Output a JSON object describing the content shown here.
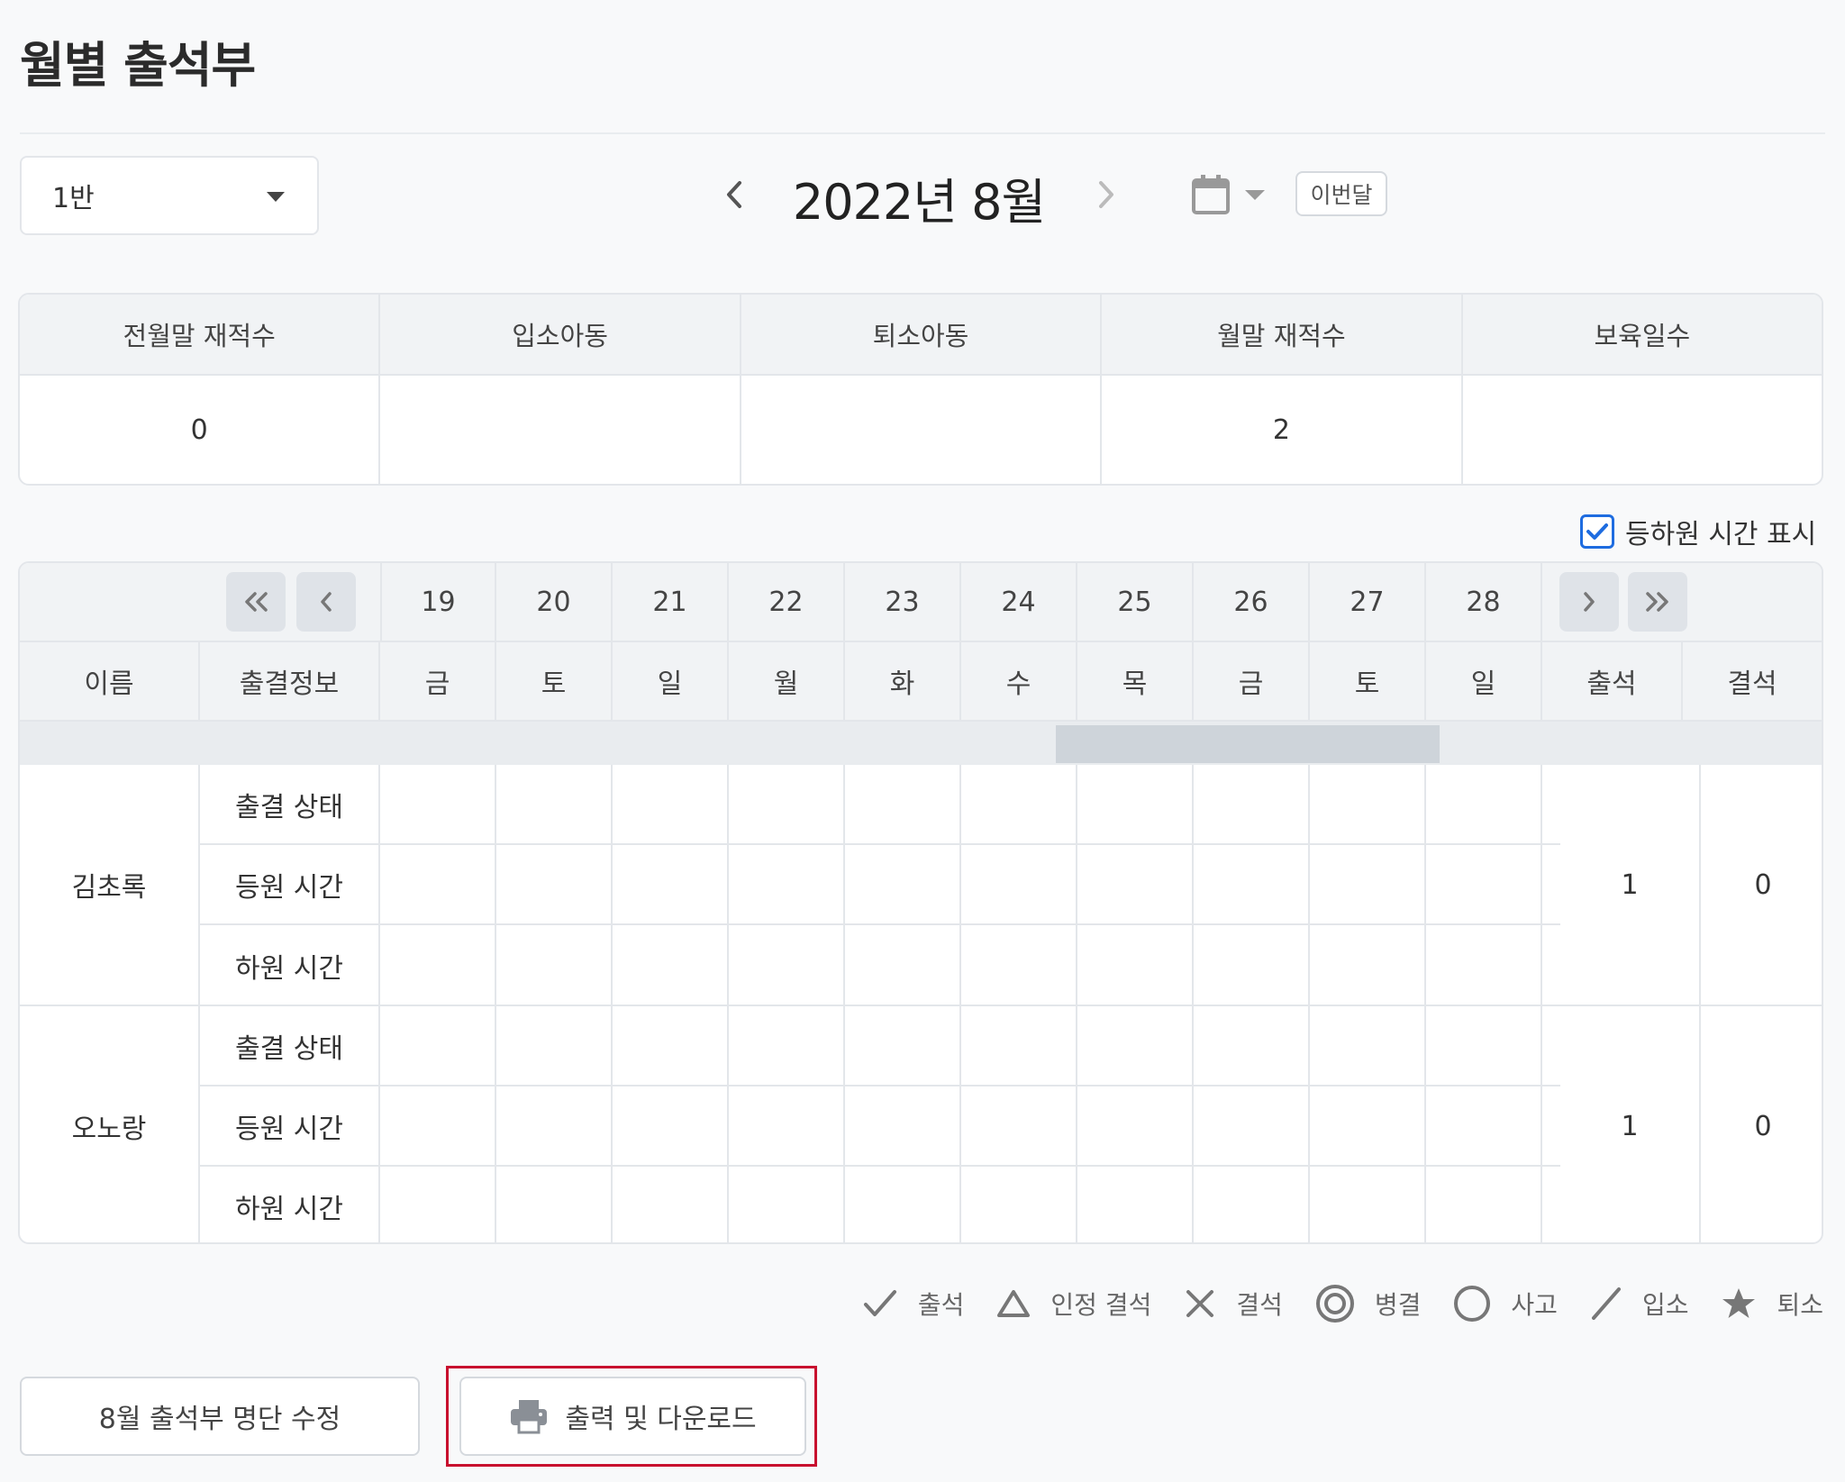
{
  "page": {
    "title": "월별 출석부"
  },
  "class_select": {
    "value": "1반"
  },
  "month_nav": {
    "label": "2022년 8월",
    "this_month_label": "이번달"
  },
  "summary": {
    "headers": [
      "전월말 재적수",
      "입소아동",
      "퇴소아동",
      "월말 재적수",
      "보육일수"
    ],
    "values": [
      "0",
      "",
      "",
      "2",
      ""
    ]
  },
  "time_toggle": {
    "label": "등하원 시간 표시",
    "checked": true
  },
  "grid": {
    "dates": [
      "19",
      "20",
      "21",
      "22",
      "23",
      "24",
      "25",
      "26",
      "27",
      "28"
    ],
    "weekdays": [
      "금",
      "토",
      "일",
      "월",
      "화",
      "수",
      "목",
      "금",
      "토",
      "일"
    ],
    "headers": {
      "name": "이름",
      "info": "출결정보",
      "present": "출석",
      "absent": "결석"
    },
    "row_labels": [
      "출결 상태",
      "등원 시간",
      "하원 시간"
    ],
    "students": [
      {
        "name": "김초록",
        "present": "1",
        "absent": "0"
      },
      {
        "name": "오노랑",
        "present": "1",
        "absent": "0"
      }
    ]
  },
  "legend": [
    {
      "icon": "check-icon",
      "label": "출석"
    },
    {
      "icon": "triangle-icon",
      "label": "인정 결석"
    },
    {
      "icon": "x-icon",
      "label": "결석"
    },
    {
      "icon": "double-circle-icon",
      "label": "병결"
    },
    {
      "icon": "circle-icon",
      "label": "사고"
    },
    {
      "icon": "slash-icon",
      "label": "입소"
    },
    {
      "icon": "star-icon",
      "label": "퇴소"
    }
  ],
  "buttons": {
    "edit_roster": "8월 출석부 명단 수정",
    "print_download": "출력 및 다운로드"
  },
  "colors": {
    "accent": "#1e6ce0",
    "highlight": "#c8102e"
  }
}
